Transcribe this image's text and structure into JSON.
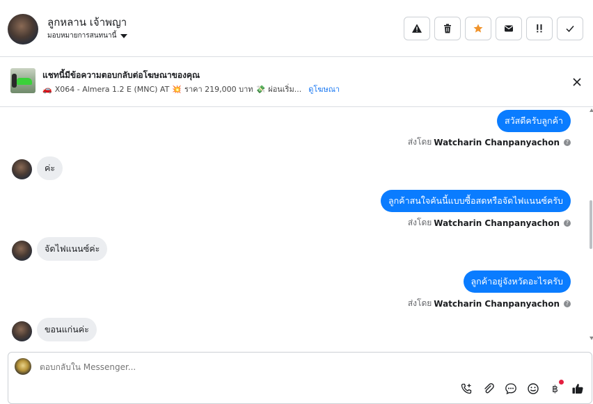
{
  "header": {
    "contact_name": "ลูกหลาน เจ้าพญา",
    "assign_label": "มอบหมายการสนทนานี้",
    "actions": [
      "spam-warning",
      "delete",
      "star",
      "mark-unread",
      "follow-up",
      "done"
    ]
  },
  "ad_banner": {
    "title": "แชทนี้มีข้อความตอบกลับต่อโฆษณาของคุณ",
    "subtitle": "X064 - Almera 1.2 E (MNC) AT",
    "price": "ราคา 219,000 บาท",
    "extra": "ผ่อนเริ่ม...",
    "link": "ดูโฆษณา"
  },
  "messages": [
    {
      "dir": "out",
      "text": "สวัสดีครับลูกค้า",
      "sent_prefix": "ส่งโดย",
      "sender": "Watcharin Chanpanyachon"
    },
    {
      "dir": "in",
      "text": "ค่ะ"
    },
    {
      "dir": "out",
      "text": "ลูกค้าสนใจคันนี้แบบซื้อสดหรือจัดไฟแนนซ์ครับ",
      "sent_prefix": "ส่งโดย",
      "sender": "Watcharin Chanpanyachon"
    },
    {
      "dir": "in",
      "text": "จัดไฟแนนซ์ค่ะ"
    },
    {
      "dir": "out",
      "text": "ลูกค้าอยู่จังหวัดอะไรครับ",
      "sent_prefix": "ส่งโดย",
      "sender": "Watcharin Chanpanyachon"
    },
    {
      "dir": "in",
      "text": "ขอนแก่นค่ะ"
    }
  ],
  "composer": {
    "placeholder": "ตอบกลับใน Messenger..."
  },
  "colors": {
    "accent": "#0a7cff",
    "incoming_bubble": "#ebedf0",
    "star": "#f0932b",
    "notification": "#e41e3f"
  }
}
